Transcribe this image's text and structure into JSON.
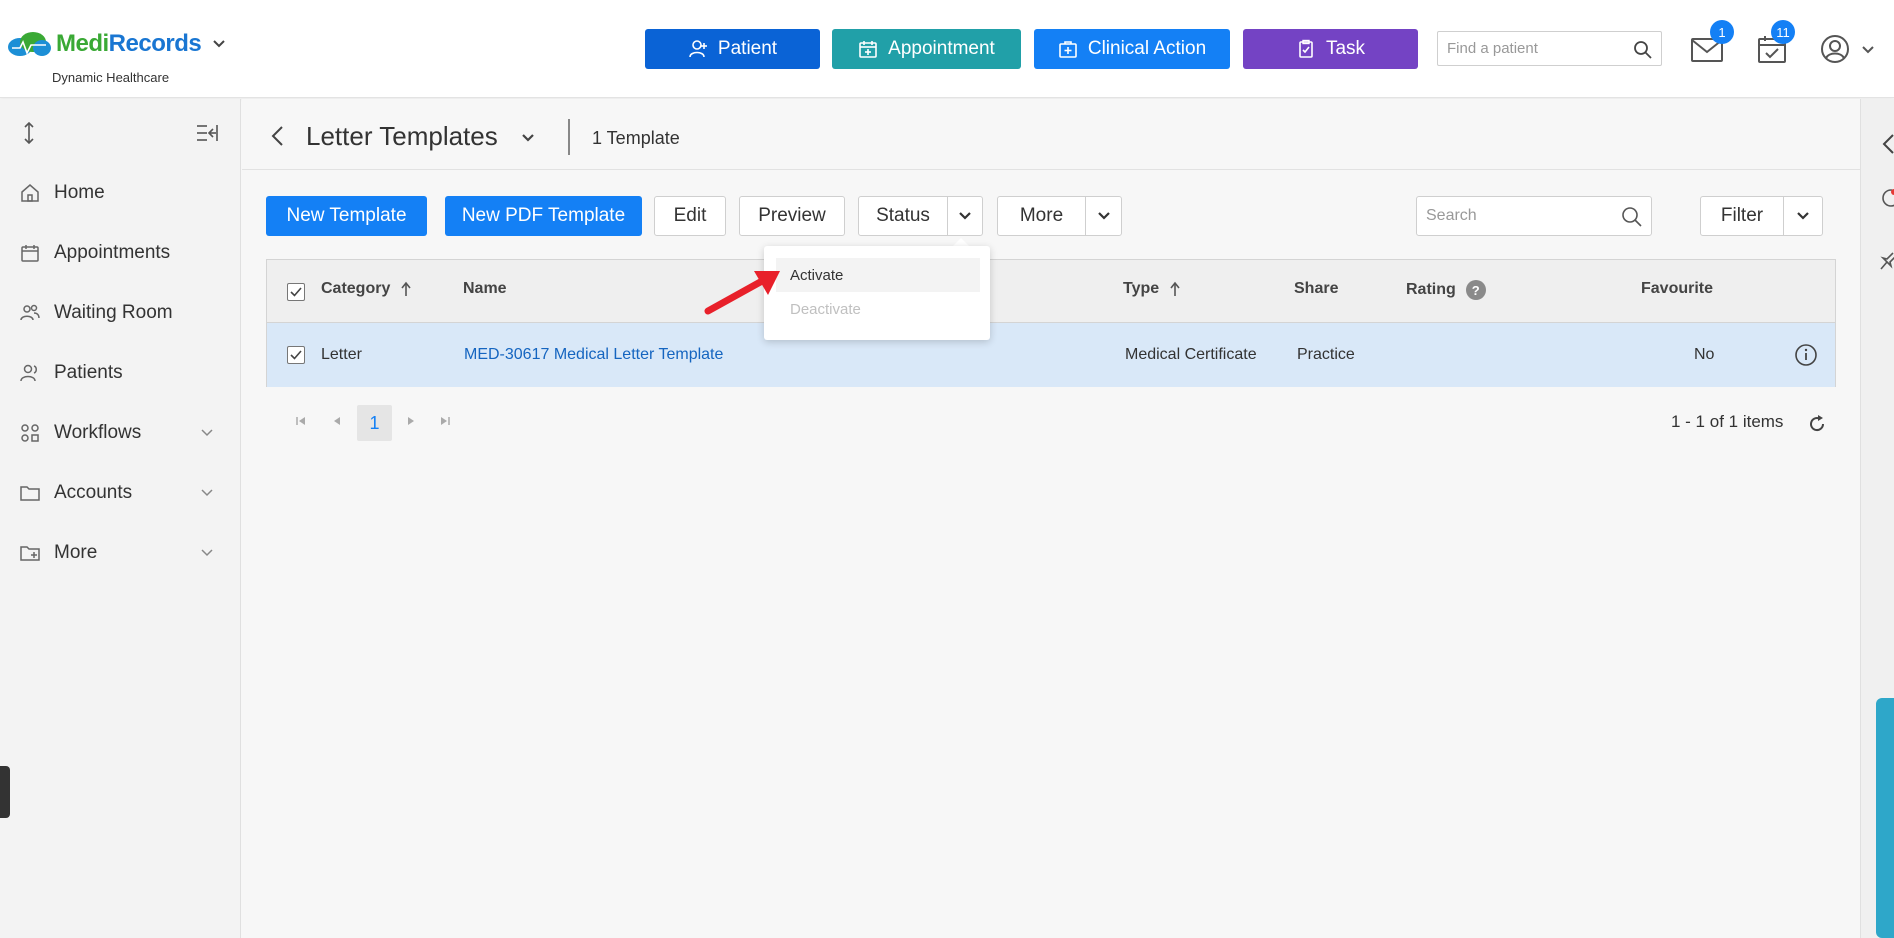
{
  "brand": {
    "name_part1": "Medi",
    "name_part2": "Records",
    "subtitle": "Dynamic Healthcare"
  },
  "quick_actions": {
    "patient": "Patient",
    "appointment": "Appointment",
    "clinical_action": "Clinical Action",
    "task": "Task"
  },
  "find_patient": {
    "placeholder": "Find a patient"
  },
  "notifications": {
    "mail_count": "1",
    "calendar_count": "11"
  },
  "sidebar": {
    "items": [
      {
        "label": "Home",
        "icon": "home-icon"
      },
      {
        "label": "Appointments",
        "icon": "calendar-icon"
      },
      {
        "label": "Waiting Room",
        "icon": "people-icon"
      },
      {
        "label": "Patients",
        "icon": "patients-icon"
      },
      {
        "label": "Workflows",
        "icon": "workflow-icon"
      },
      {
        "label": "Accounts",
        "icon": "folder-icon"
      },
      {
        "label": "More",
        "icon": "folder-plus-icon"
      }
    ]
  },
  "breadcrumb": {
    "title": "Letter Templates",
    "count": "1 Template"
  },
  "toolbar": {
    "new_template": "New Template",
    "new_pdf_template": "New PDF Template",
    "edit": "Edit",
    "preview": "Preview",
    "status": "Status",
    "more": "More",
    "filter": "Filter",
    "search_placeholder": "Search"
  },
  "status_menu": {
    "activate": "Activate",
    "deactivate": "Deactivate"
  },
  "table": {
    "headers": {
      "category": "Category",
      "name": "Name",
      "type": "Type",
      "share": "Share",
      "rating": "Rating",
      "favourite": "Favourite"
    },
    "rows": [
      {
        "category": "Letter",
        "name": "MED-30617 Medical Letter Template",
        "type": "Medical Certificate",
        "share": "Practice",
        "rating": "",
        "favourite": "No"
      }
    ]
  },
  "pager": {
    "current_page": "1",
    "items_text": "1 - 1 of 1 items"
  },
  "colors": {
    "patient": "#0a63d6",
    "appointment": "#21a0a8",
    "clinical_action": "#1480f5",
    "task": "#7443c4",
    "primary": "#1480f5",
    "selected_row": "#d9e8f8",
    "arrow": "#e8202a"
  }
}
